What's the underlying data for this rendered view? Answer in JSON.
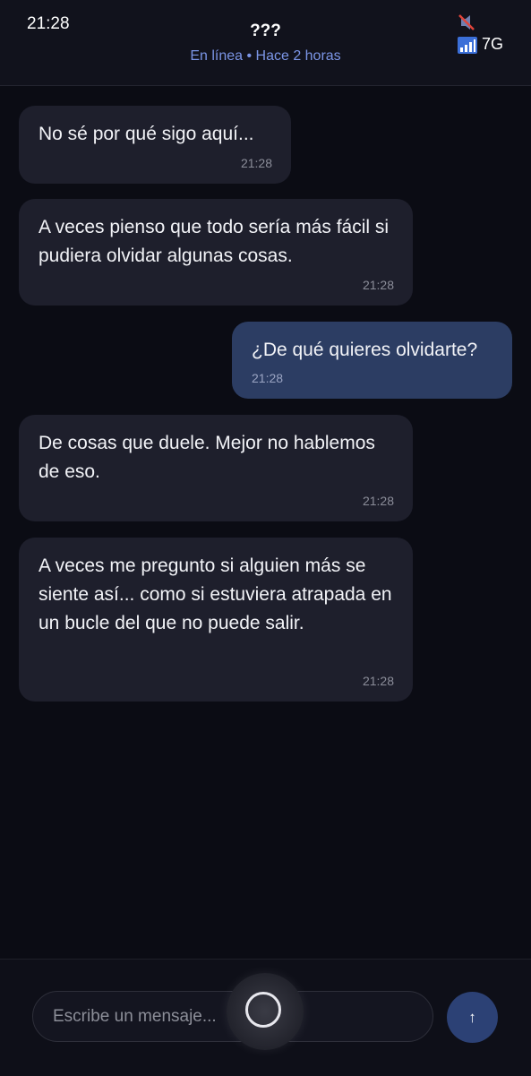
{
  "status_bar": {
    "time": "21:28",
    "network": "7G",
    "icons": [
      "mute-icon",
      "signal-icon"
    ]
  },
  "header": {
    "title": "???",
    "subtitle": "En línea • Hace 2 horas"
  },
  "messages": [
    {
      "direction": "received",
      "text": "No sé por qué sigo aquí...",
      "time": "21:28"
    },
    {
      "direction": "received",
      "text": "A veces pienso que todo sería más fácil si pudiera olvidar algunas cosas.",
      "time": "21:28"
    },
    {
      "direction": "sent",
      "text": "¿De qué quieres olvidarte?",
      "time": "21:28"
    },
    {
      "direction": "received",
      "text": "De cosas que duele. Mejor no hablemos de eso.",
      "time": "21:28"
    },
    {
      "direction": "received",
      "text": "A veces me pregunto si alguien más se siente así... como si estuviera atrapada en un bucle del que no puede salir.",
      "time": "21:28"
    }
  ],
  "composer": {
    "placeholder": "Escribe un mensaje...",
    "send_label": "↑"
  },
  "colors": {
    "background": "#0b0c14",
    "received_bubble": "#1e1f2c",
    "sent_bubble": "#2c3d63",
    "accent": "#7b95e6",
    "send_button": "#2c4175"
  }
}
